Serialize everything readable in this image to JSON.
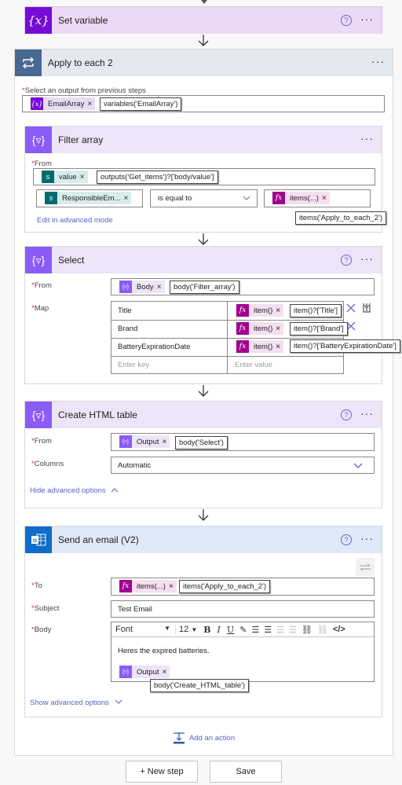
{
  "set_variable": {
    "title": "Set variable",
    "icon": "variable-icon",
    "icon_glyph": "{x}"
  },
  "apply_to_each": {
    "title": "Apply to each 2",
    "icon": "loop-icon",
    "select_label": "Select an output from previous steps",
    "token": {
      "name": "EmailArray",
      "icon_glyph": "{x}",
      "tooltip": "variables('EmailArray')"
    }
  },
  "filter_array": {
    "title": "Filter array",
    "from_label": "From",
    "from_token": {
      "name": "value",
      "tooltip": "outputs('Get_items')?['body/value']"
    },
    "left_token": {
      "name": "ResponsibleEm..."
    },
    "operator": "is equal to",
    "right_token": {
      "name": "items(...)",
      "tooltip": "items('Apply_to_each_2')"
    },
    "advanced_link": "Edit in advanced mode"
  },
  "select": {
    "title": "Select",
    "from_label": "From",
    "from_token": {
      "name": "Body",
      "tooltip": "body('Filter_array')"
    },
    "map_label": "Map",
    "map_rows": [
      {
        "key": "Title",
        "value_token": "item()",
        "tooltip": "item()?['Title']"
      },
      {
        "key": "Brand",
        "value_token": "item()",
        "tooltip": "item()?['Brand']"
      },
      {
        "key": "BatteryExpirationDate",
        "value_token": "item()",
        "tooltip": "item()?['BatteryExpirationDate']"
      }
    ],
    "key_placeholder": "Enter key",
    "value_placeholder": "Enter value"
  },
  "create_html_table": {
    "title": "Create HTML table",
    "from_label": "From",
    "from_token": {
      "name": "Output",
      "tooltip": "body('Select')"
    },
    "columns_label": "Columns",
    "columns_value": "Automatic",
    "advanced_link": "Hide advanced options"
  },
  "send_email": {
    "title": "Send an email (V2)",
    "to_label": "To",
    "to_token": {
      "name": "items(...)",
      "tooltip": "items('Apply_to_each_2')"
    },
    "subject_label": "Subject",
    "subject_value": "Test Email",
    "body_label": "Body",
    "toolbar": {
      "font": "Font",
      "size": "12"
    },
    "body_text": "Heres the expired batteries.",
    "body_token": {
      "name": "Output",
      "tooltip": "body('Create_HTML_table')"
    },
    "advanced_link": "Show advanced options"
  },
  "add_action": "Add an action",
  "buttons": {
    "new_step": "+ New step",
    "save": "Save"
  },
  "common": {
    "help": "?",
    "more": "···",
    "remove": "×",
    "fx": "fx",
    "da": "{▿}"
  },
  "colors": {
    "set_variable": "#770bd6",
    "loop": "#486991",
    "data_operation": "#8a5cf5",
    "outlook": "#0f6cc8",
    "sharepoint": "#036c70",
    "expression": "#a2008e",
    "link": "#5b5fc7"
  }
}
